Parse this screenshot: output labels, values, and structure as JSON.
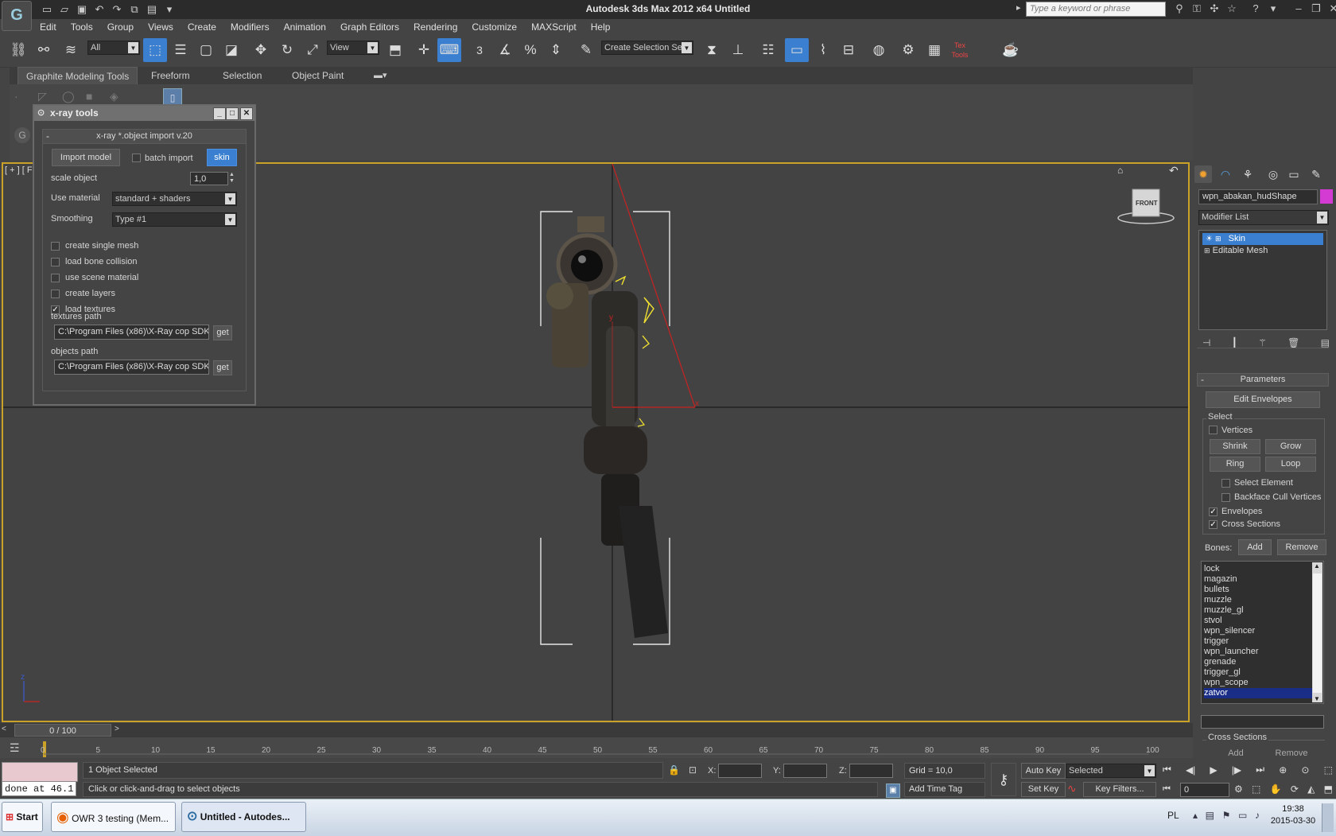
{
  "app": {
    "title": "Autodesk 3ds Max  2012 x64     Untitled",
    "search_placeholder": "Type a keyword or phrase",
    "logo_glyph": "G"
  },
  "menu": [
    "Edit",
    "Tools",
    "Group",
    "Views",
    "Create",
    "Modifiers",
    "Animation",
    "Graph Editors",
    "Rendering",
    "Customize",
    "MAXScript",
    "Help"
  ],
  "toolbar": {
    "filter_value": "All",
    "refcoord_value": "View",
    "selection_set_value": "Create Selection Se",
    "snap_label": "3",
    "textools_label": "Tex Tools"
  },
  "ribbon": {
    "tabs": [
      "Graphite Modeling Tools",
      "Freeform",
      "Selection",
      "Object Paint"
    ]
  },
  "viewport": {
    "label": "[ + ] [ F",
    "viewcube_label": "FRONT",
    "axis_x": "x",
    "axis_y": "y",
    "axis_z": "z"
  },
  "xray": {
    "window_title": "x-ray tools",
    "rollout_title": "x-ray *.object import v.20",
    "rollout_toggle": "-",
    "import_button": "Import model",
    "batch_import_label": "batch import",
    "skin_button": "skin",
    "scale_label": "scale object",
    "scale_value": "1,0",
    "material_label": "Use material",
    "material_value": "standard + shaders",
    "smoothing_label": "Smoothing",
    "smoothing_value": "Type #1",
    "checkboxes": [
      {
        "label": "create single mesh",
        "checked": false
      },
      {
        "label": "load bone collision",
        "checked": false
      },
      {
        "label": "use scene material",
        "checked": false
      },
      {
        "label": "create layers",
        "checked": false
      },
      {
        "label": "load textures",
        "checked": true
      }
    ],
    "textures_path_label": "textures path",
    "textures_path_value": "C:\\Program Files (x86)\\X-Ray cop SDK\\",
    "objects_path_label": "objects path",
    "objects_path_value": "C:\\Program Files (x86)\\X-Ray cop SDK\\",
    "get_label": "get"
  },
  "command_panel": {
    "object_name": "wpn_abakan_hudShape",
    "object_color": "#d33bd3",
    "modifier_list": "Modifier List",
    "stack": [
      "Skin",
      "Editable Mesh"
    ],
    "parameters_title": "Parameters",
    "edit_envelopes": "Edit Envelopes",
    "select_group": "Select",
    "vertices": "Vertices",
    "shrink": "Shrink",
    "grow": "Grow",
    "ring": "Ring",
    "loop": "Loop",
    "select_element": "Select Element",
    "backface_cull": "Backface Cull Vertices",
    "envelopes": "Envelopes",
    "cross_sections": "Cross Sections",
    "bones_label": "Bones:",
    "add": "Add",
    "remove": "Remove",
    "bones": [
      "lock",
      "magazin",
      "bullets",
      "muzzle",
      "muzzle_gl",
      "stvol",
      "wpn_silencer",
      "trigger",
      "wpn_launcher",
      "grenade",
      "trigger_gl",
      "wpn_scope",
      "zatvor"
    ],
    "cross_sections_group": "Cross Sections",
    "add_partial": "Add",
    "remove_partial": "Remove"
  },
  "timeline": {
    "frame": "0 / 100",
    "ticks": [
      "0",
      "5",
      "10",
      "15",
      "20",
      "25",
      "30",
      "35",
      "40",
      "45",
      "50",
      "55",
      "60",
      "65",
      "70",
      "75",
      "80",
      "85",
      "90",
      "95",
      "100"
    ]
  },
  "status": {
    "script_output": "done at 46.1",
    "selected": "1 Object Selected",
    "prompt": "Click or click-and-drag to select objects",
    "x_label": "X:",
    "y_label": "Y:",
    "z_label": "Z:",
    "grid": "Grid = 10,0",
    "add_time_tag": "Add Time Tag",
    "auto_key": "Auto Key",
    "set_key": "Set Key",
    "key_mode": "Selected",
    "key_filters": "Key Filters...",
    "frame_field": "0"
  },
  "taskbar": {
    "start": "Start",
    "tasks": [
      "OWR 3 testing (Mem...",
      "Untitled - Autodes..."
    ],
    "lang": "PL",
    "time": "19:38",
    "date": "2015-03-30"
  }
}
